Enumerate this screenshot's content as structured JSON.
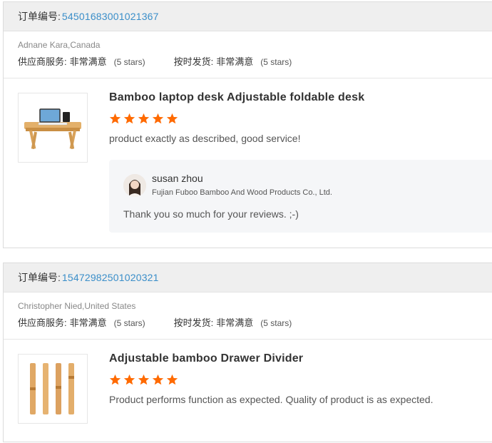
{
  "orders": [
    {
      "order_label": "订单编号:",
      "order_number": "54501683001021367",
      "buyer": "Adnane Kara,Canada",
      "supplier_service_label": "供应商服务:",
      "supplier_service_value": "非常满意",
      "supplier_service_stars": "(5 stars)",
      "on_time_label": "按时发货:",
      "on_time_value": "非常满意",
      "on_time_stars": "(5 stars)",
      "product_title": "Bamboo laptop desk Adjustable foldable desk",
      "rating": 5,
      "review": "product exactly as described, good service!",
      "reply": {
        "name": "susan zhou",
        "company": "Fujian Fuboo Bamboo And Wood Products Co., Ltd.",
        "text": "Thank you so much for your reviews. ;-)"
      }
    },
    {
      "order_label": "订单编号:",
      "order_number": "15472982501020321",
      "buyer": "Christopher Nied,United States",
      "supplier_service_label": "供应商服务:",
      "supplier_service_value": "非常满意",
      "supplier_service_stars": "(5 stars)",
      "on_time_label": "按时发货:",
      "on_time_value": "非常满意",
      "on_time_stars": "(5 stars)",
      "product_title": "Adjustable bamboo Drawer Divider",
      "rating": 5,
      "review": "Product performs function as expected. Quality of product is as expected."
    }
  ],
  "colors": {
    "link": "#3a8ec9",
    "star": "#ff6a00",
    "header_bg": "#efefef"
  },
  "icons": {
    "star": "star-icon",
    "product1": "laptop-desk-image",
    "product2": "drawer-divider-image",
    "avatar": "avatar"
  }
}
